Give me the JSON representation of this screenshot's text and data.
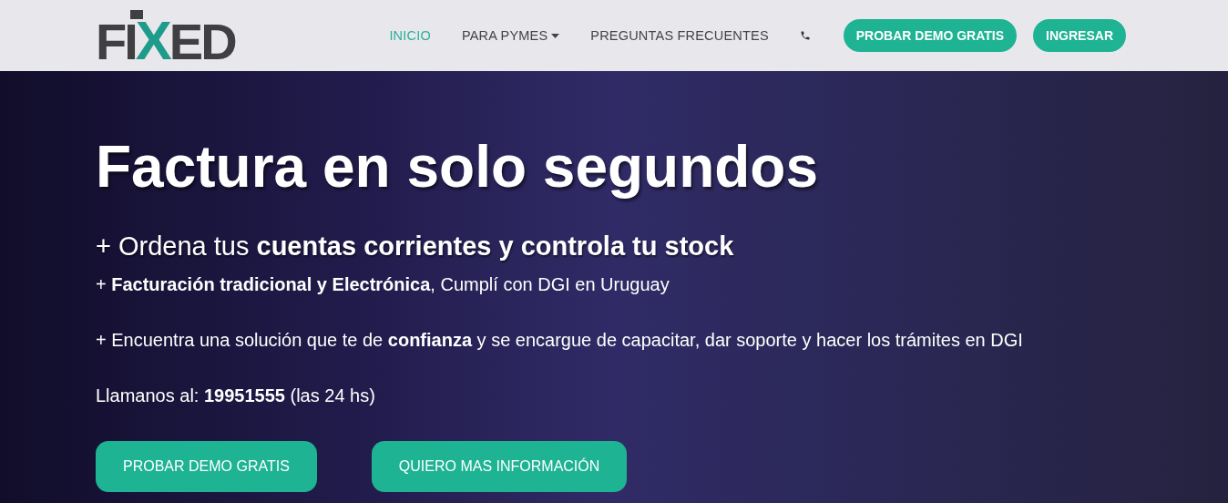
{
  "logo": {
    "text": "FIXED"
  },
  "nav": {
    "items": [
      {
        "label": "INICIO",
        "selected": true,
        "dropdown": false
      },
      {
        "label": "PARA PYMES",
        "selected": false,
        "dropdown": true
      },
      {
        "label": "PREGUNTAS FRECUENTES",
        "selected": false,
        "dropdown": false
      }
    ],
    "buttons": [
      "PROBAR DEMO GRATIS",
      "INGRESAR"
    ]
  },
  "hero": {
    "title": "Factura en solo segundos",
    "lead": "+ Ordena tus **cuentas corrientes y controla tu stock**",
    "points": [
      "+ **Facturación tradicional y Electrónica**, Cumplí con DGI en Uruguay",
      "+ Encuentra una solución que te de **confianza** y se encargue de capacitar, dar soporte y hacer los trámites en DGI"
    ],
    "phone": "Llamanos al: **19951555** (las 24 hs)",
    "buttons": [
      "PROBAR DEMO GRATIS",
      "QUIERO MAS INFORMACIÓN"
    ]
  }
}
